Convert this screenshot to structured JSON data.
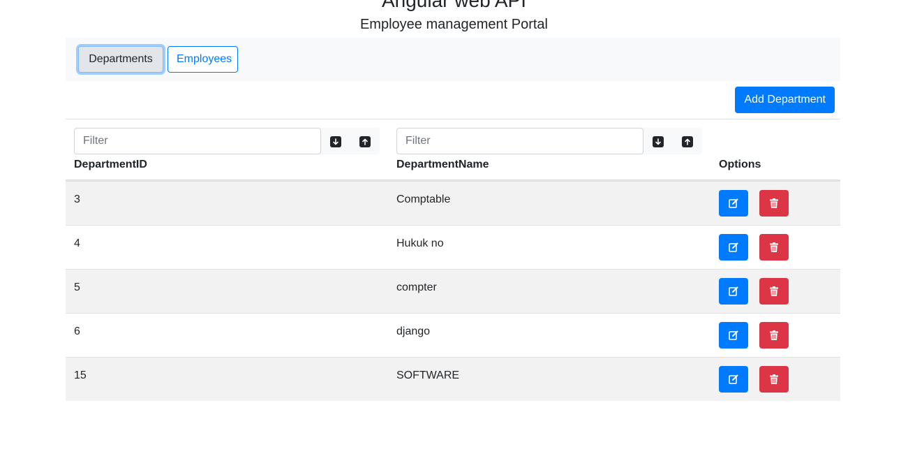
{
  "header": {
    "title": "Angular web API",
    "subtitle": "Employee management Portal"
  },
  "nav": {
    "departments_label": "Departments",
    "employees_label": "Employees"
  },
  "toolbar": {
    "add_label": "Add Department"
  },
  "table": {
    "columns": [
      {
        "label": "DepartmentID",
        "filter_placeholder": "Filter"
      },
      {
        "label": "DepartmentName",
        "filter_placeholder": "Filter"
      },
      {
        "label": "Options"
      }
    ],
    "rows": [
      {
        "id": "3",
        "name": "Comptable"
      },
      {
        "id": "4",
        "name": "Hukuk no"
      },
      {
        "id": "5",
        "name": "compter"
      },
      {
        "id": "6",
        "name": "django"
      },
      {
        "id": "15",
        "name": "SOFTWARE"
      }
    ]
  },
  "icons": {
    "sort_asc": "arrow-down-icon",
    "sort_desc": "arrow-up-icon",
    "edit": "pencil-square-icon",
    "delete": "trash-icon"
  },
  "colors": {
    "primary": "#007bff",
    "danger": "#dc3545",
    "stripe": "#f2f2f2",
    "navbar_bg": "#f8f9fa"
  }
}
